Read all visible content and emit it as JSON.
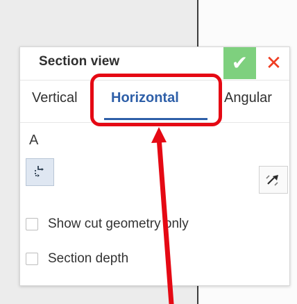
{
  "panel": {
    "title": "Section view",
    "accept_icon": "check-icon",
    "accept_glyph": "✔",
    "cancel_icon": "close-icon",
    "cancel_glyph": "✕"
  },
  "tabs": [
    {
      "label": "Vertical"
    },
    {
      "label": "Horizontal"
    },
    {
      "label": "Angular"
    }
  ],
  "selected_tab": "Horizontal",
  "fields": {
    "section_label": "A"
  },
  "tools": {
    "section_tool_icon": "section-path-icon",
    "flip_tool_icon": "flip-direction-icon"
  },
  "options": [
    {
      "label": "Show cut geometry only",
      "checked": false
    },
    {
      "label": "Section depth",
      "checked": false
    }
  ],
  "annotation": {
    "highlight_color": "#e50914",
    "arrow_color": "#e50914"
  }
}
